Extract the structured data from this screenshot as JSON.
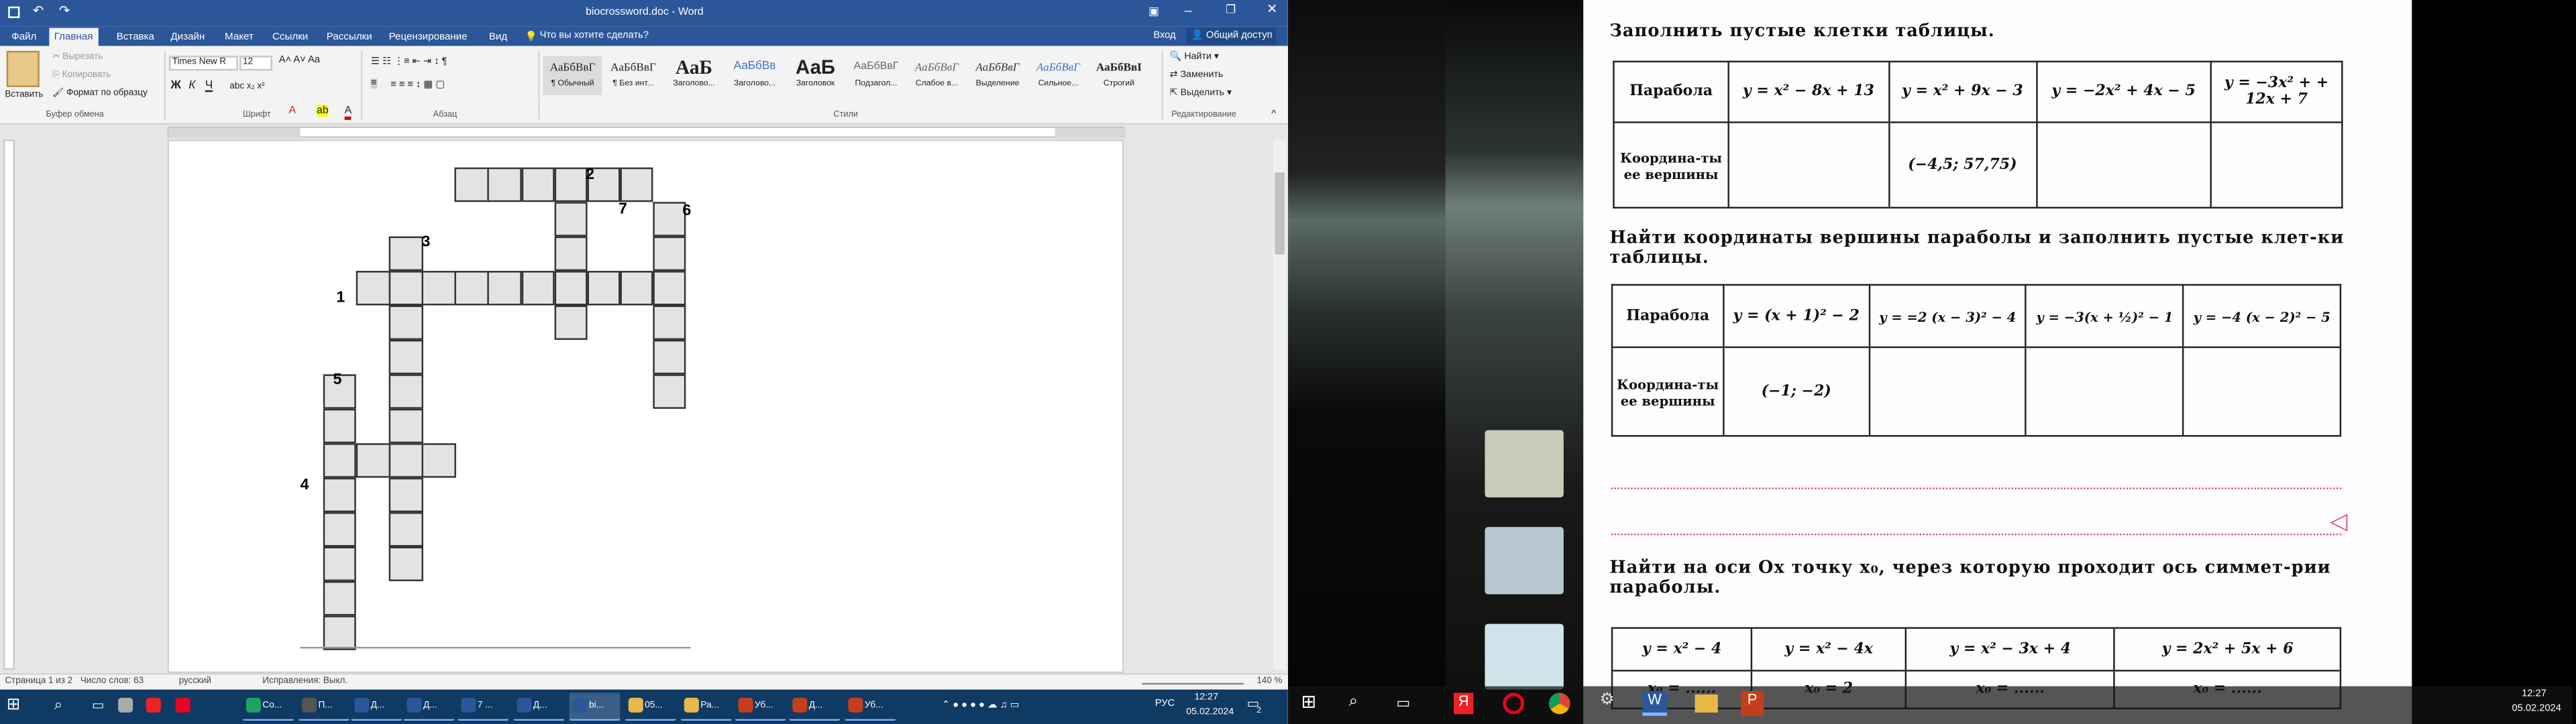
{
  "word": {
    "title": "biocrossword.doc - Word",
    "tabs": [
      "Файл",
      "Главная",
      "Вставка",
      "Дизайн",
      "Макет",
      "Ссылки",
      "Рассылки",
      "Рецензирование",
      "Вид"
    ],
    "tell_me": "Что вы хотите сделать?",
    "signin": "Вход",
    "share": "Общий доступ",
    "clipboard": {
      "paste": "Вставить",
      "cut": "Вырезать",
      "copy": "Копировать",
      "format_painter": "Формат по образцу",
      "group": "Буфер обмена"
    },
    "font": {
      "name": "Times New R",
      "size": "12",
      "group": "Шрифт"
    },
    "paragraph_group": "Абзац",
    "styles": [
      {
        "sample": "АаБбВвГ",
        "label": "¶ Обычный"
      },
      {
        "sample": "АаБбВвГ",
        "label": "¶ Без инт..."
      },
      {
        "sample": "АаБ",
        "label": "Заголово..."
      },
      {
        "sample": "АаБбВв",
        "label": "Заголово..."
      },
      {
        "sample": "АаБ",
        "label": "Заголовок"
      },
      {
        "sample": "АаБбВвГ",
        "label": "Подзагол..."
      },
      {
        "sample": "АаБбВвГ",
        "label": "Слабое в..."
      },
      {
        "sample": "АаБбВвГ",
        "label": "Выделение"
      },
      {
        "sample": "АаБбВвГ",
        "label": "Сильное..."
      },
      {
        "sample": "АаБбВвI",
        "label": "Строгий"
      }
    ],
    "styles_group": "Стили",
    "editing": {
      "find": "Найти",
      "replace": "Заменить",
      "select": "Выделить",
      "group": "Редактирование"
    },
    "crossword_numbers": [
      "1",
      "2",
      "3",
      "4",
      "5",
      "6",
      "7"
    ],
    "status": {
      "page": "Страница 1 из 2",
      "words": "Число слов: 63",
      "lang": "русский",
      "track": "Исправления: Выкл.",
      "zoom": "140 %"
    }
  },
  "taskbar_left": {
    "items": [
      "Co...",
      "П...",
      "Д...",
      "Д...",
      "7 ...",
      "Д...",
      "bi...",
      "05...",
      "Ра...",
      "Уб...",
      "Д...",
      "Уб..."
    ],
    "lang": "РУС",
    "time": "12:27",
    "date": "05.02.2024",
    "notif": "2"
  },
  "taskbar_right": {
    "time": "12:27",
    "date": "05.02.2024"
  },
  "textbook": {
    "heading1": "Заполнить пустые клетки таблицы.",
    "table1": {
      "row_header1": "Парабола",
      "formulas": [
        "y = x² − 8x + 13",
        "y = x² + 9x − 3",
        "y = −2x² + 4x − 5",
        "y = −3x² + + 12x + 7"
      ],
      "row_header2": "Координа-ты ее вершины",
      "values": [
        "",
        "(−4,5; 57,75)",
        "",
        ""
      ]
    },
    "heading2": "Найти координаты вершины параболы и заполнить пустые клет-ки таблицы.",
    "table2": {
      "row_header1": "Парабола",
      "formulas": [
        "y = (x + 1)² − 2",
        "y = =2 (x − 3)² − 4",
        "y = −3(x + ½)² − 1",
        "y = −4 (x − 2)² − 5"
      ],
      "row_header2": "Координа-ты ее вершины",
      "values": [
        "(−1; −2)",
        "",
        "",
        ""
      ]
    },
    "heading3": "Найти на оси Ox точку x₀, через которую проходит ось симмет-рии параболы.",
    "table3": {
      "formulas": [
        "y = x² − 4",
        "y = x² − 4x",
        "y = x² − 3x + 4",
        "y = 2x² + 5x + 6"
      ],
      "values": [
        "x₀ = ......",
        "x₀ = 2",
        "x₀ = ......",
        "x₀ = ......"
      ]
    }
  }
}
